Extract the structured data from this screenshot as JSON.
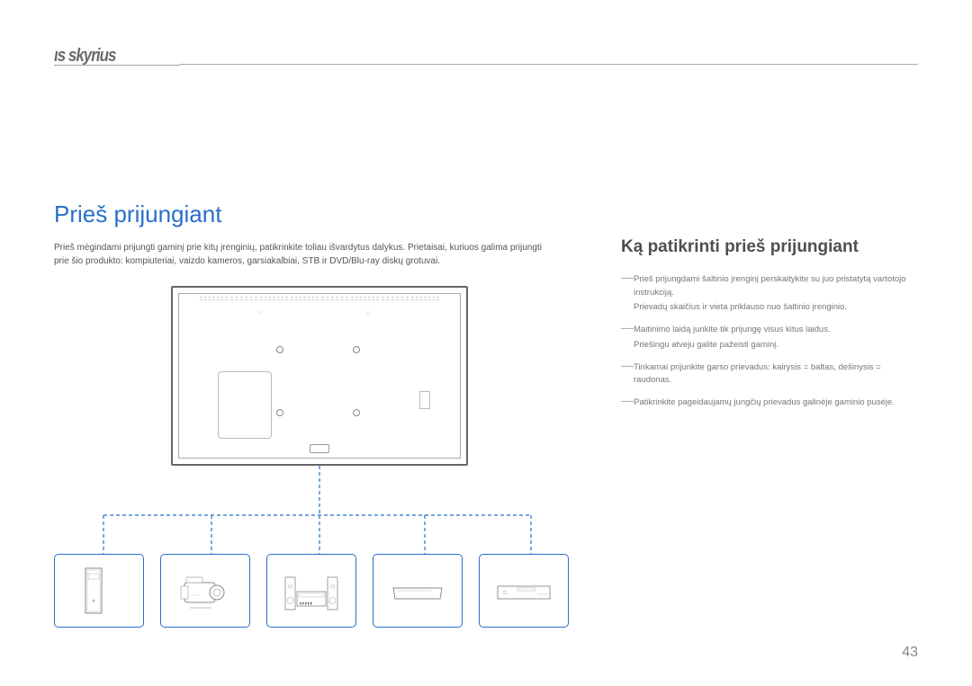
{
  "chapter": {
    "title_fragment": "ıs skyrius"
  },
  "section": {
    "title": "Prieš prijungiant"
  },
  "intro": {
    "text": "Prieš mėgindami prijungti gaminį prie kitų įrenginių, patikrinkite toliau išvardytus dalykus. Prietaisai, kuriuos galima prijungti prie šio produkto: kompiuteriai, vaizdo kameros, garsiakalbiai, STB ir DVD/Blu-ray diskų grotuvai."
  },
  "right": {
    "subheading": "Ką patikrinti prieš prijungiant",
    "notes": [
      {
        "main": "Prieš prijungdami šaltinio įrenginį perskaitykite su juo pristatytą vartotojo instrukciją.",
        "sub": "Prievadų skaičius ir vieta priklauso nuo šaltinio įrenginio."
      },
      {
        "main": "Maitinimo laidą junkite tik prijungę visus kitus laidus.",
        "sub": "Priešingu atveju galite pažeisti gaminį."
      },
      {
        "main": "Tinkamai prijunkite garso prievadus: kairysis = baltas, dešinysis = raudonas.",
        "sub": null
      },
      {
        "main": "Patikrinkite pageidaujamų jungčių prievadus galinėje gaminio pusėje.",
        "sub": null
      }
    ]
  },
  "page_number": "43"
}
